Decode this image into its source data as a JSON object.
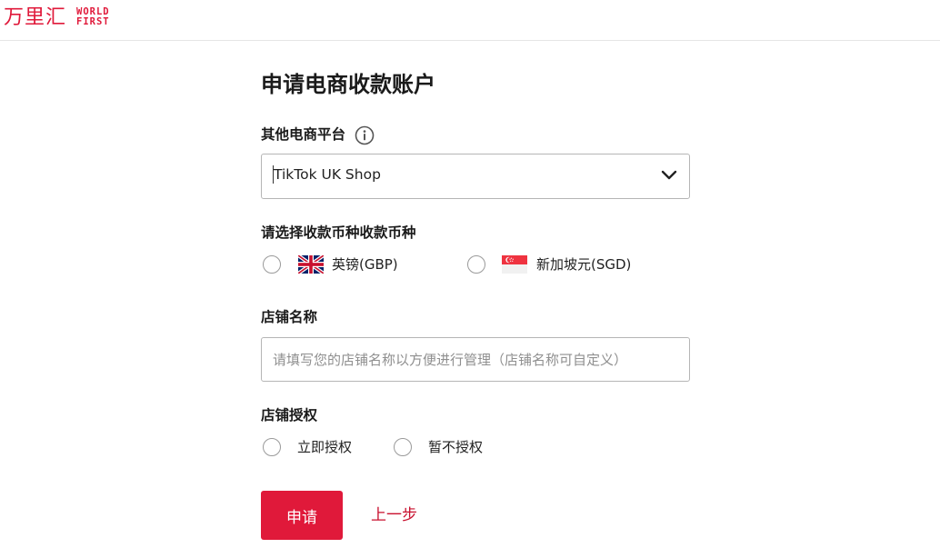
{
  "header": {
    "logo_cn": "万里汇",
    "logo_en_line1": "WORLD",
    "logo_en_line2": "FIRST",
    "brand_color": "#e0193a"
  },
  "form": {
    "title": "申请电商收款账户",
    "platform": {
      "label": "其他电商平台",
      "info_icon": "info-icon",
      "selected_value": "TikTok UK Shop",
      "chevron_icon": "chevron-down-icon"
    },
    "currency": {
      "label": "请选择收款币种收款币种",
      "options": [
        {
          "label": "英镑(GBP)",
          "flag": "uk-flag-icon",
          "selected": false
        },
        {
          "label": "新加坡元(SGD)",
          "flag": "singapore-flag-icon",
          "selected": false
        }
      ]
    },
    "store_name": {
      "label": "店铺名称",
      "value": "",
      "placeholder": "请填写您的店铺名称以方便进行管理（店铺名称可自定义）"
    },
    "authorization": {
      "label": "店铺授权",
      "options": [
        {
          "label": "立即授权",
          "selected": false
        },
        {
          "label": "暂不授权",
          "selected": false
        }
      ]
    },
    "actions": {
      "submit_label": "申请",
      "back_label": "上一步"
    }
  }
}
